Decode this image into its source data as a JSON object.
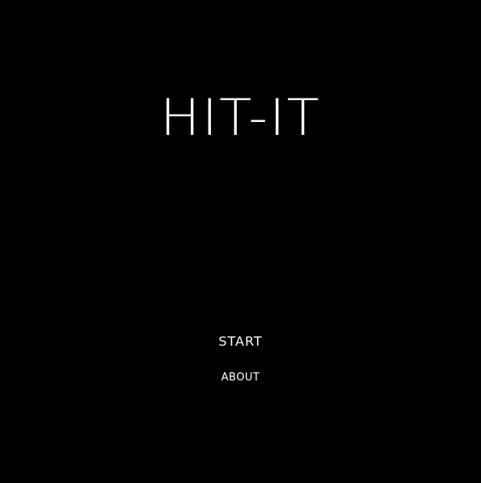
{
  "game": {
    "title": "HIT-IT",
    "menu": {
      "start_label": "START",
      "about_label": "ABOUT"
    }
  },
  "colors": {
    "background": "#000000",
    "text": "#ffffff"
  }
}
